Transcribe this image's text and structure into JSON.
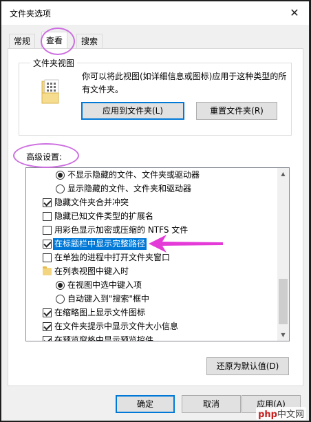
{
  "window": {
    "title": "文件夹选项",
    "close_icon": "close-icon"
  },
  "tabs": [
    {
      "label": "常规",
      "active": false
    },
    {
      "label": "查看",
      "active": true
    },
    {
      "label": "搜索",
      "active": false
    }
  ],
  "folder_views": {
    "group_title": "文件夹视图",
    "description": "你可以将此视图(如详细信息或图标)应用于这种类型的所有文件夹。",
    "apply_button": "应用到文件夹(L)",
    "reset_button": "重置文件夹(R)"
  },
  "advanced": {
    "label": "高级设置:",
    "items": [
      {
        "type": "radio",
        "checked": true,
        "text": "不显示隐藏的文件、文件夹或驱动器"
      },
      {
        "type": "radio",
        "checked": false,
        "text": "显示隐藏的文件、文件夹和驱动器"
      },
      {
        "type": "checkbox",
        "checked": true,
        "text": "隐藏文件夹合并冲突"
      },
      {
        "type": "checkbox",
        "checked": false,
        "text": "隐藏已知文件类型的扩展名"
      },
      {
        "type": "checkbox",
        "checked": false,
        "text": "用彩色显示加密或压缩的 NTFS 文件"
      },
      {
        "type": "checkbox",
        "checked": true,
        "selected": true,
        "text": "在标题栏中显示完整路径"
      },
      {
        "type": "checkbox",
        "checked": false,
        "text": "在单独的进程中打开文件夹窗口"
      },
      {
        "type": "folder",
        "text": "在列表视图中键入时"
      },
      {
        "type": "radio",
        "checked": true,
        "text": "在视图中选中键入项"
      },
      {
        "type": "radio",
        "checked": false,
        "text": "自动键入到\"搜索\"框中"
      },
      {
        "type": "checkbox",
        "checked": true,
        "text": "在缩略图上显示文件图标"
      },
      {
        "type": "checkbox",
        "checked": true,
        "text": "在文件夹提示中显示文件大小信息"
      },
      {
        "type": "checkbox",
        "checked": true,
        "text": "在预览窗格中显示预览控件"
      }
    ],
    "restore_button": "还原为默认值(D)"
  },
  "footer": {
    "ok": "确定",
    "cancel": "取消",
    "apply": "应用(A)"
  },
  "watermark": {
    "brand": "php",
    "tail": "中文网"
  },
  "annotation_color": "#e43bd8",
  "accent_color": "#0078d7"
}
